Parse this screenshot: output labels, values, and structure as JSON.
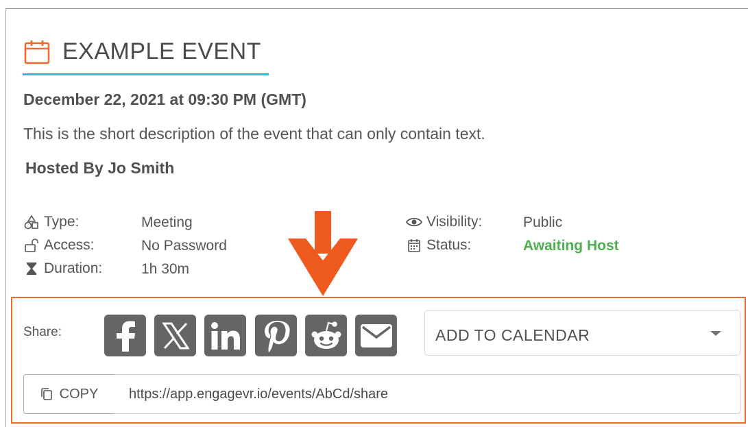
{
  "event": {
    "title": "EXAMPLE EVENT",
    "datetime": "December 22, 2021 at 09:30 PM (GMT)",
    "description": "This is the short description of the event that can only contain text.",
    "host": "Hosted By Jo Smith"
  },
  "details": {
    "type": {
      "label": "Type:",
      "value": "Meeting",
      "icon": "shapes-icon"
    },
    "access": {
      "label": "Access:",
      "value": "No Password",
      "icon": "unlock-icon"
    },
    "duration": {
      "label": "Duration:",
      "value": "1h 30m",
      "icon": "hourglass-icon"
    },
    "visibility": {
      "label": "Visibility:",
      "value": "Public",
      "icon": "eye-icon"
    },
    "status": {
      "label": "Status:",
      "value": "Awaiting Host",
      "icon": "calendar-icon",
      "color": "#4caf50"
    }
  },
  "share": {
    "label": "Share:",
    "networks": [
      "facebook",
      "x",
      "linkedin",
      "pinterest",
      "reddit",
      "email"
    ],
    "calendar_select": "ADD TO CALENDAR",
    "copy_label": "COPY",
    "url": "https://app.engagevr.io/events/AbCd/share"
  },
  "colors": {
    "accent_underline": "#29b6e8",
    "highlight": "#ef6a2a",
    "icon_bg": "#636566",
    "status_green": "#4caf50"
  }
}
